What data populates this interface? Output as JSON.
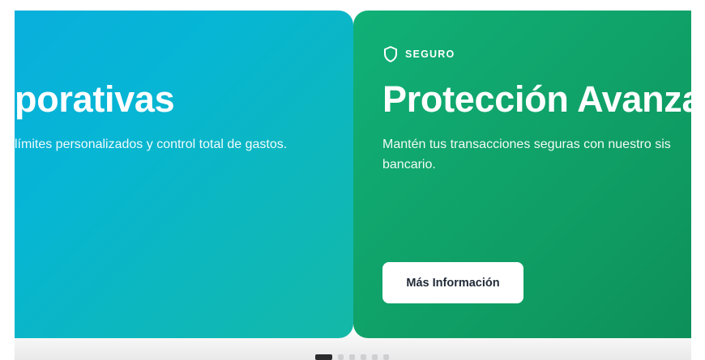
{
  "carousel": {
    "slides": [
      {
        "title": "porativas",
        "description": "límites personalizados y control total de gastos."
      },
      {
        "badge": "SEGURO",
        "badge_icon": "shield-icon",
        "title": "Protección Avanza",
        "description": "Mantén tus transacciones seguras con nuestro sis bancario.",
        "cta_label": "Más Información"
      }
    ],
    "dots_count": 6,
    "active_dot": 0
  },
  "colors": {
    "slide_1_gradient": [
      "#0ea5e9",
      "#14b8a6"
    ],
    "slide_2_gradient": [
      "#10b077",
      "#0a7a4a"
    ],
    "button_bg": "#ffffff",
    "button_text": "#1f2937",
    "dot_active": "#2b2b2e",
    "dot_inactive": "#cfcfd2"
  }
}
